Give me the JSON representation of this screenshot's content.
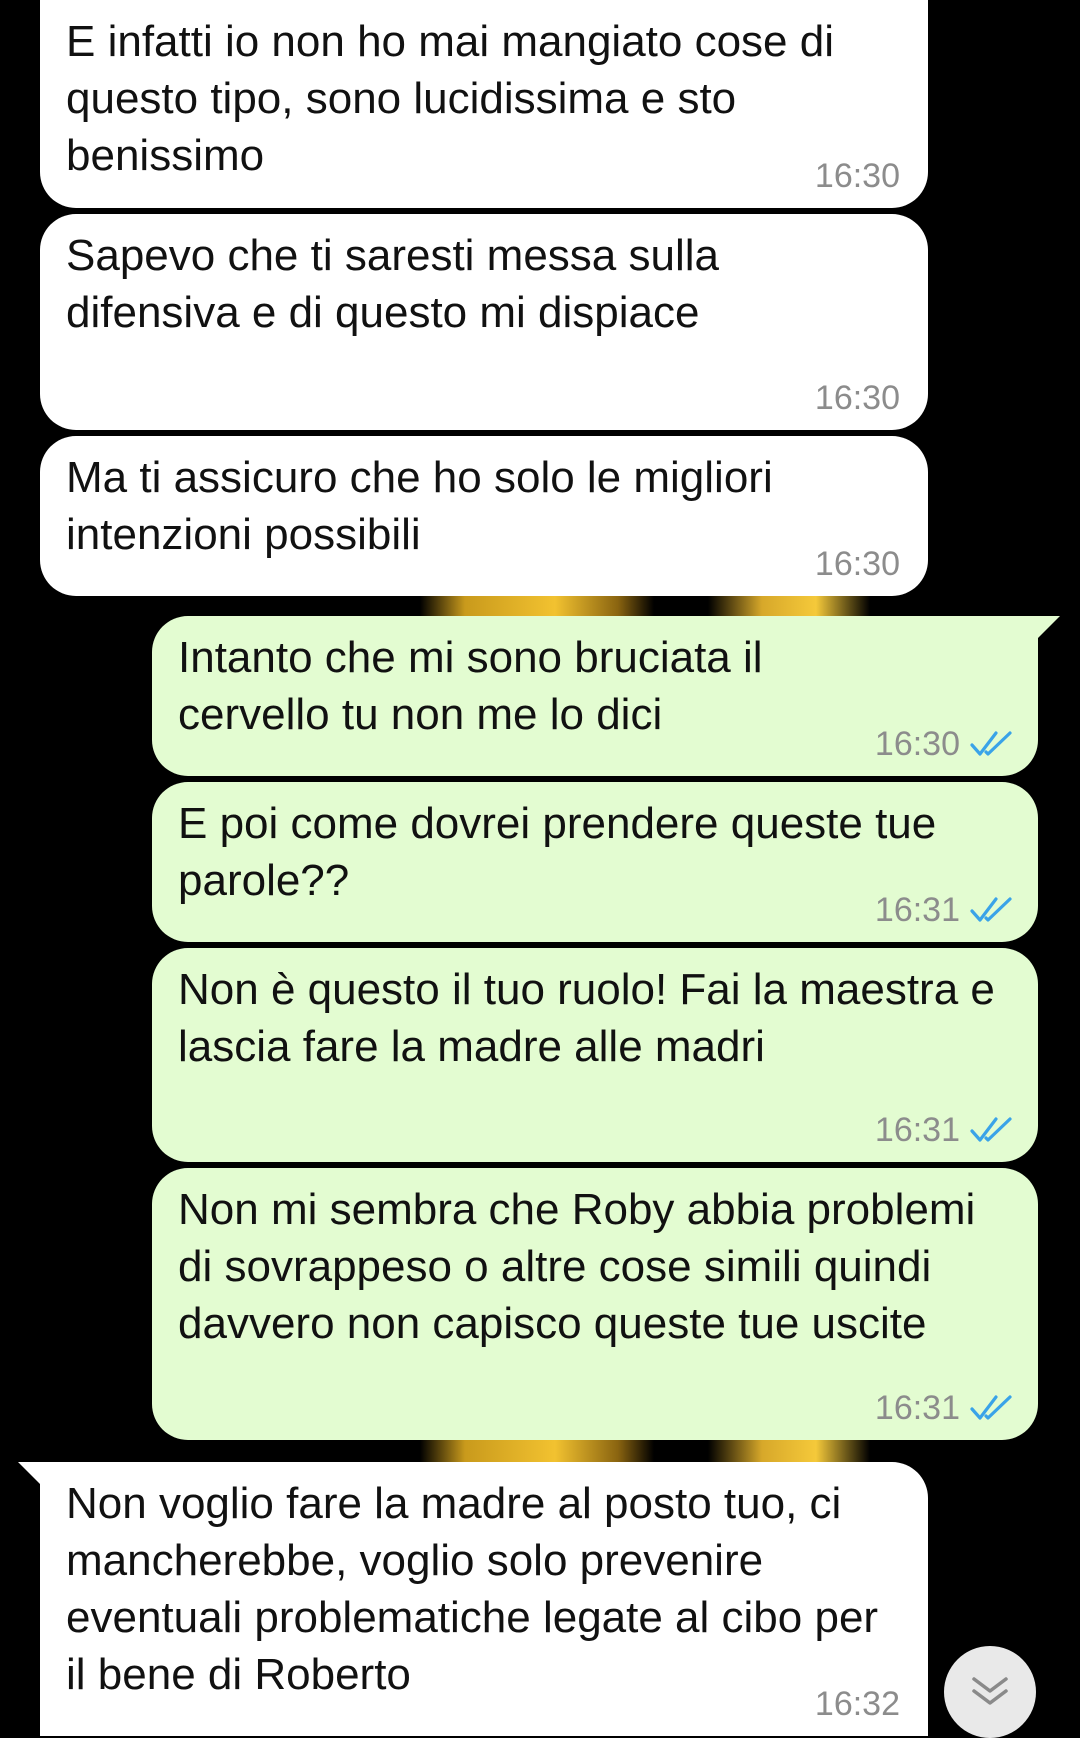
{
  "colors": {
    "incoming_bubble": "#ffffff",
    "outgoing_bubble": "#e3fcd1",
    "background": "#000000",
    "read_checks": "#3aa3e8",
    "timestamp": "#8c8c8c"
  },
  "messages": [
    {
      "direction": "incoming",
      "text": "E infatti io non ho mai mangiato cose di questo tipo, sono lucidissima e sto benissimo",
      "time": "16:30"
    },
    {
      "direction": "incoming",
      "text": "Sapevo che ti saresti messa sulla difensiva e di questo mi dispiace",
      "time": "16:30"
    },
    {
      "direction": "incoming",
      "text": "Ma ti assicuro che ho solo le migliori intenzioni possibili",
      "time": "16:30"
    },
    {
      "direction": "outgoing",
      "text": "Intanto che mi sono bruciata il cervello tu non me lo dici",
      "time": "16:30",
      "status_icon": "double-check-read-icon"
    },
    {
      "direction": "outgoing",
      "text": "E poi come dovrei prendere queste tue parole??",
      "time": "16:31",
      "status_icon": "double-check-read-icon"
    },
    {
      "direction": "outgoing",
      "text": "Non è questo il tuo ruolo! Fai la maestra e lascia fare la madre alle madri",
      "time": "16:31",
      "status_icon": "double-check-read-icon"
    },
    {
      "direction": "outgoing",
      "text": "Non mi sembra che Roby abbia problemi di sovrappeso o altre cose simili quindi davvero non capisco queste tue uscite",
      "time": "16:31",
      "status_icon": "double-check-read-icon"
    },
    {
      "direction": "incoming",
      "text": "Non voglio fare la madre al posto tuo, ci mancherebbe, voglio solo prevenire eventuali problematiche legate al cibo per il bene di Roberto",
      "time": "16:32"
    }
  ],
  "scroll_button": {
    "icon": "double-chevron-down-icon"
  }
}
